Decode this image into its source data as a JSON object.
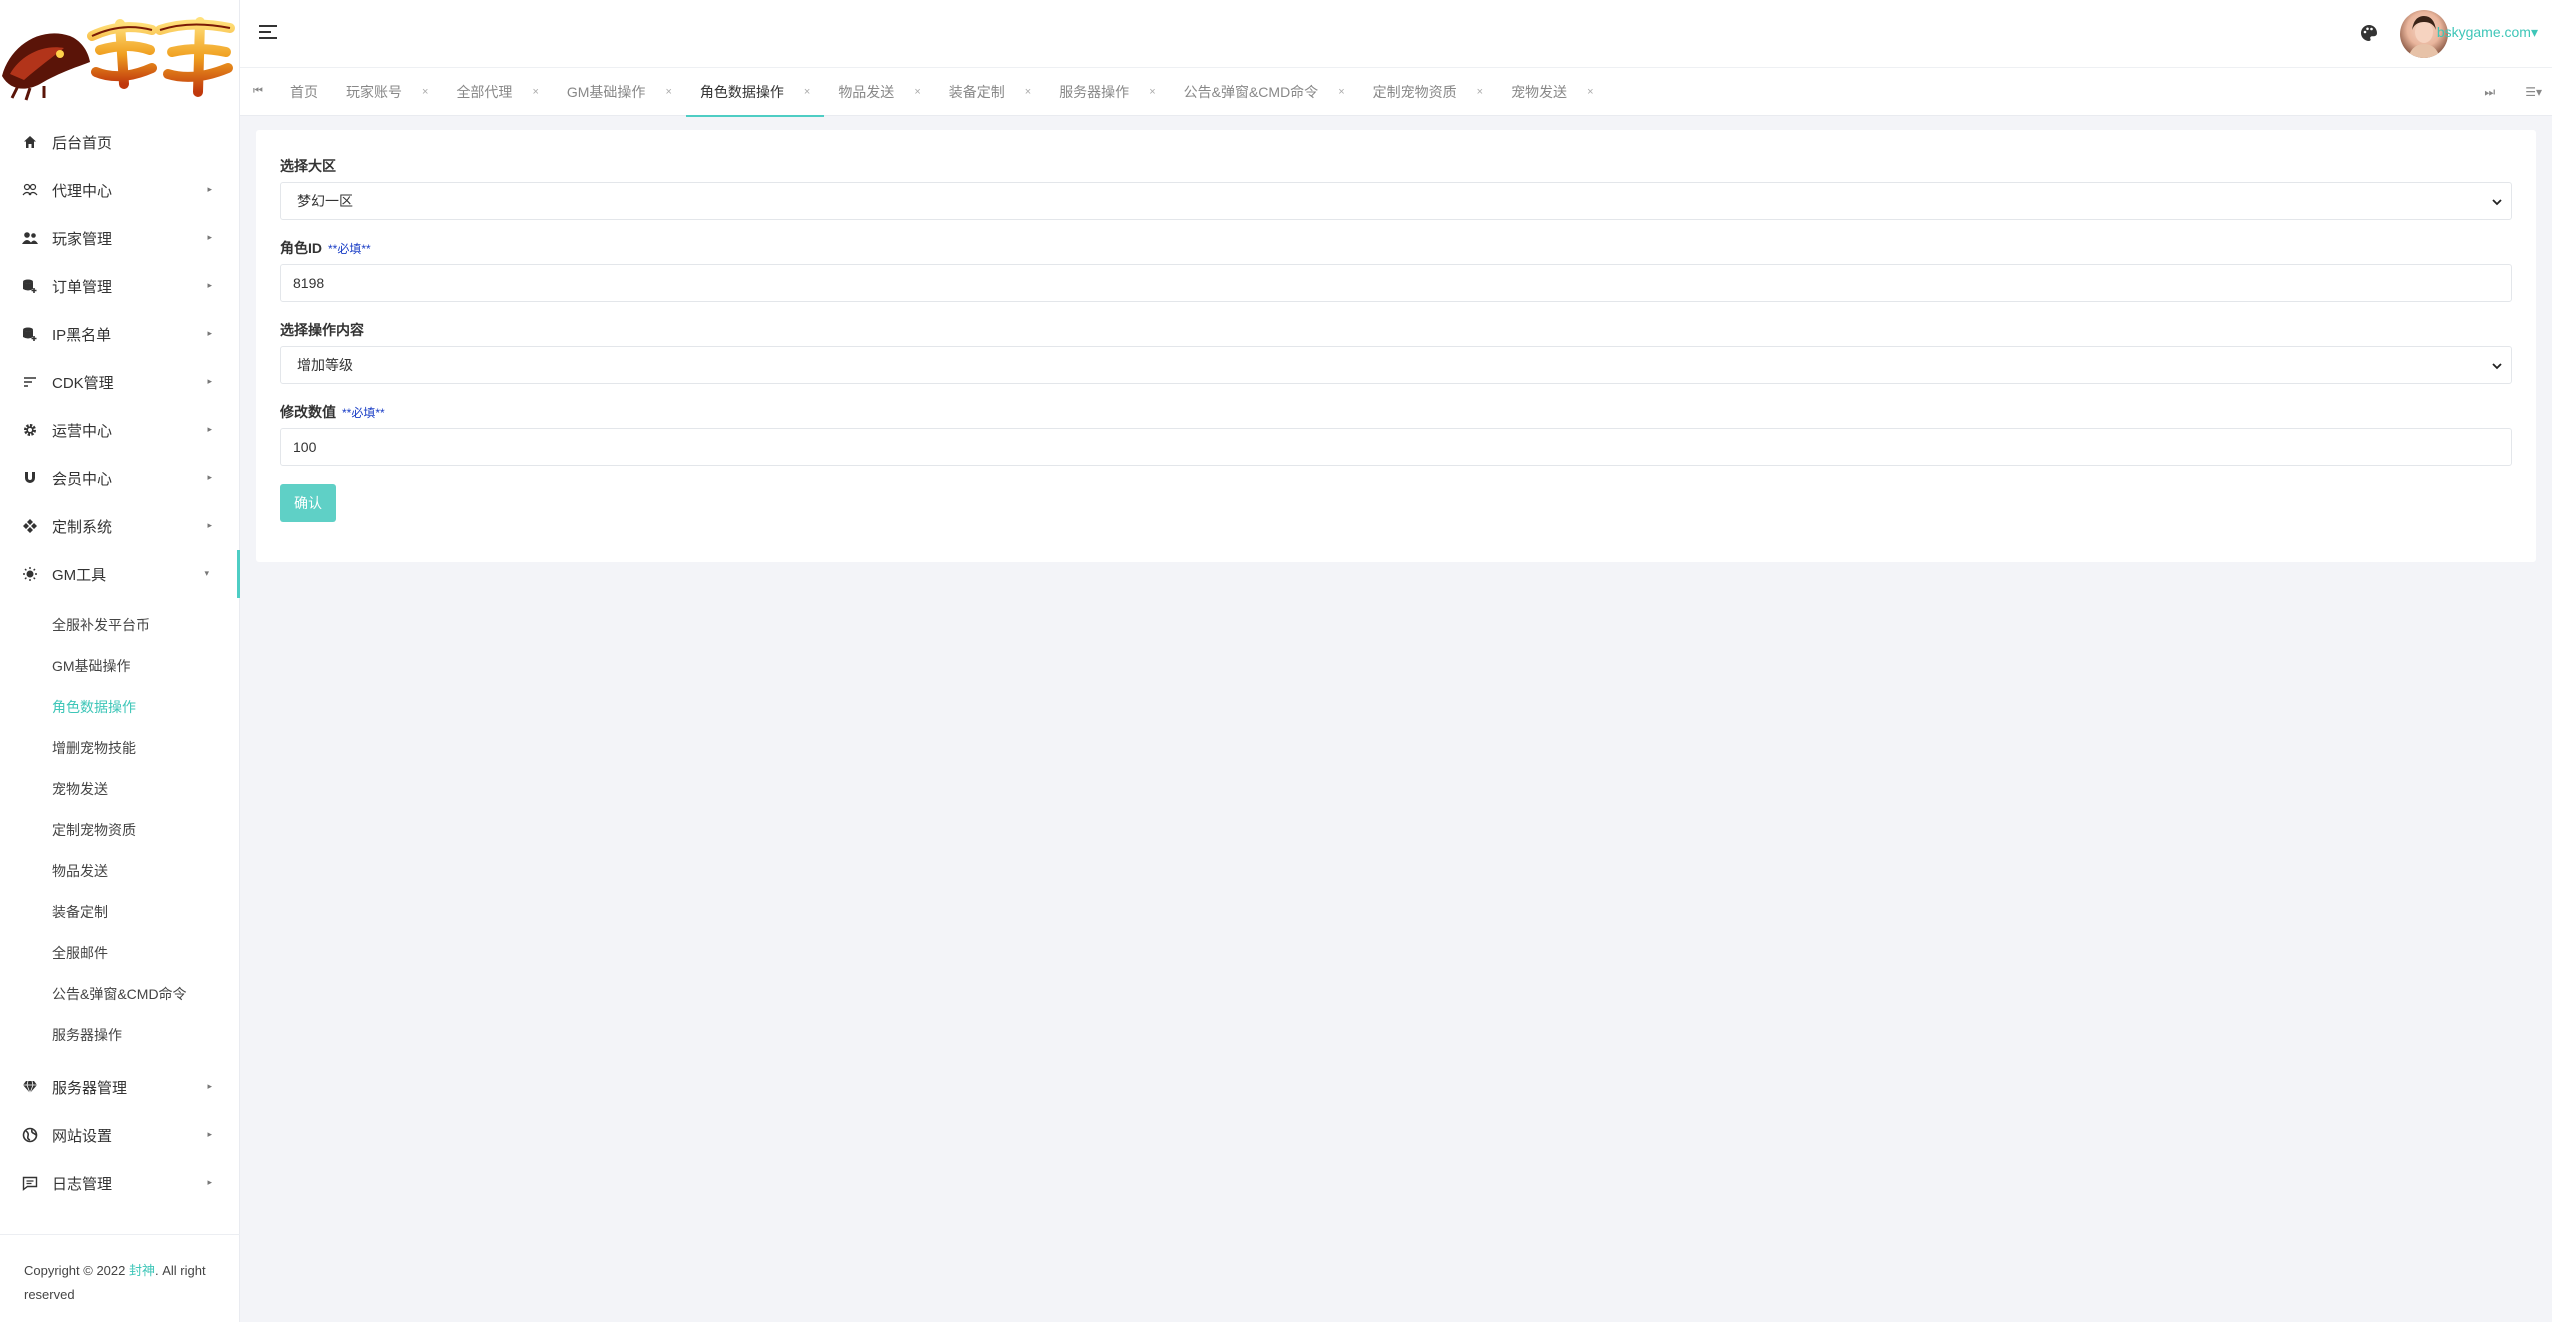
{
  "sidebar": {
    "nav": [
      {
        "label": "后台首页",
        "icon": "home-icon",
        "has_children": false
      },
      {
        "label": "代理中心",
        "icon": "users-outline-icon",
        "has_children": true
      },
      {
        "label": "玩家管理",
        "icon": "users-icon",
        "has_children": true
      },
      {
        "label": "订单管理",
        "icon": "database-plus-icon",
        "has_children": true
      },
      {
        "label": "IP黑名单",
        "icon": "database-plus-icon",
        "has_children": true
      },
      {
        "label": "CDK管理",
        "icon": "sort-lines-icon",
        "has_children": true
      },
      {
        "label": "运营中心",
        "icon": "gear-icon",
        "has_children": true
      },
      {
        "label": "会员中心",
        "icon": "magnet-icon",
        "has_children": true
      },
      {
        "label": "定制系统",
        "icon": "gamepad-icon",
        "has_children": true
      },
      {
        "label": "GM工具",
        "icon": "lightbulb-icon",
        "has_children": true,
        "expanded": true
      }
    ],
    "gm_submenu": [
      {
        "label": "全服补发平台币"
      },
      {
        "label": "GM基础操作"
      },
      {
        "label": "角色数据操作",
        "current": true
      },
      {
        "label": "增删宠物技能"
      },
      {
        "label": "宠物发送"
      },
      {
        "label": "定制宠物资质"
      },
      {
        "label": "物品发送"
      },
      {
        "label": "装备定制"
      },
      {
        "label": "全服邮件"
      },
      {
        "label": "公告&弹窗&CMD命令"
      },
      {
        "label": "服务器操作"
      }
    ],
    "nav_after": [
      {
        "label": "服务器管理",
        "icon": "diamond-icon",
        "has_children": true
      },
      {
        "label": "网站设置",
        "icon": "globe-icon",
        "has_children": true
      },
      {
        "label": "日志管理",
        "icon": "chat-icon",
        "has_children": true
      }
    ],
    "footer": {
      "prefix": "Copyright © 2022 ",
      "brand": "封神",
      "suffix": ". All right reserved"
    }
  },
  "header": {
    "user_name": "bskygame.com",
    "caret": "▾"
  },
  "tabs": [
    {
      "label": "首页",
      "closable": false
    },
    {
      "label": "玩家账号",
      "closable": true
    },
    {
      "label": "全部代理",
      "closable": true
    },
    {
      "label": "GM基础操作",
      "closable": true
    },
    {
      "label": "角色数据操作",
      "closable": true,
      "active": true
    },
    {
      "label": "物品发送",
      "closable": true
    },
    {
      "label": "装备定制",
      "closable": true
    },
    {
      "label": "服务器操作",
      "closable": true
    },
    {
      "label": "公告&弹窗&CMD命令",
      "closable": true
    },
    {
      "label": "定制宠物资质",
      "closable": true
    },
    {
      "label": "宠物发送",
      "closable": true
    }
  ],
  "form": {
    "region_label": "选择大区",
    "region_value": "梦幻一区",
    "role_id_label": "角色ID",
    "role_id_required": "**必填**",
    "role_id_value": "8198",
    "operation_label": "选择操作内容",
    "operation_value": "增加等级",
    "amount_label": "修改数值",
    "amount_required": "**必填**",
    "amount_value": "100",
    "confirm_label": "确认"
  },
  "colors": {
    "accent": "#4ecdc4",
    "button": "#5fd0c6",
    "required": "#1a3ec6"
  }
}
